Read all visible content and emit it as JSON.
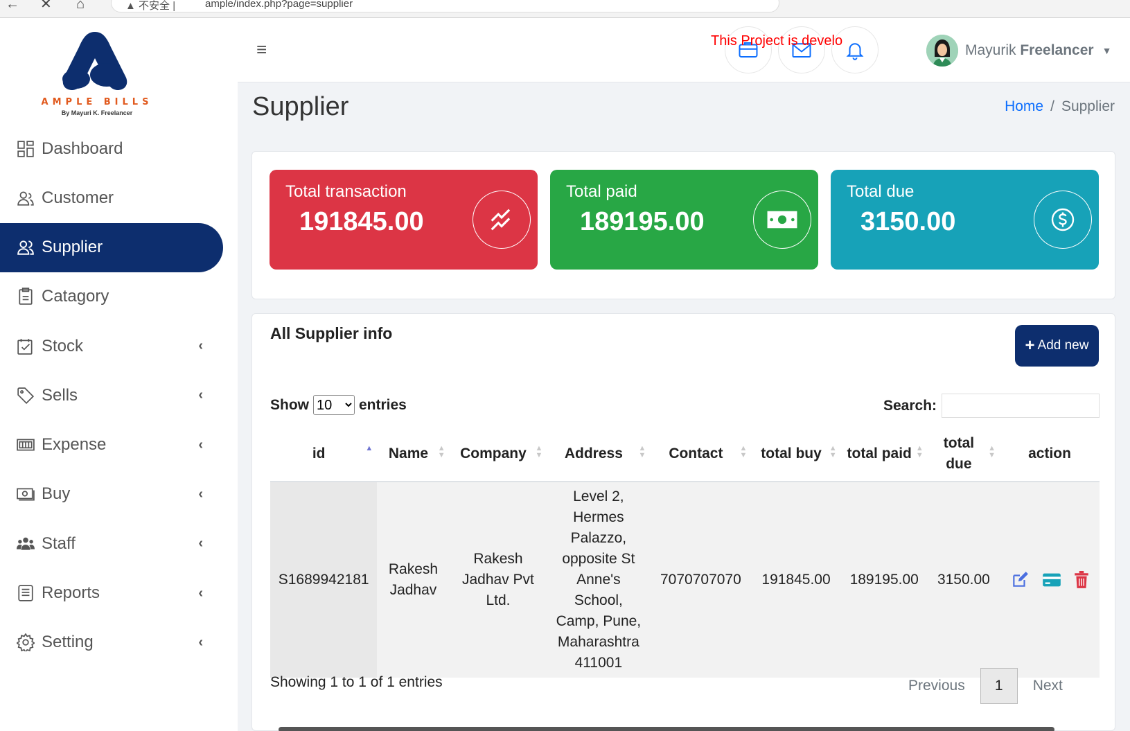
{
  "browser": {
    "url_warning": "不安全",
    "url": "ample/index.php?page=supplier"
  },
  "brand": {
    "name": "AMPLE BILLS",
    "byline": "By Mayuri K. Freelancer",
    "color": "#0d2e6e",
    "accent": "#e15a1e"
  },
  "sidebar": {
    "items": [
      {
        "label": "Dashboard",
        "icon": "dashboard-icon",
        "active": false,
        "expandable": false
      },
      {
        "label": "Customer",
        "icon": "customer-icon",
        "active": false,
        "expandable": false
      },
      {
        "label": "Supplier",
        "icon": "supplier-icon",
        "active": true,
        "expandable": false
      },
      {
        "label": "Catagory",
        "icon": "category-icon",
        "active": false,
        "expandable": false
      },
      {
        "label": "Stock",
        "icon": "stock-icon",
        "active": false,
        "expandable": true
      },
      {
        "label": "Sells",
        "icon": "tag-icon",
        "active": false,
        "expandable": true
      },
      {
        "label": "Expense",
        "icon": "expense-icon",
        "active": false,
        "expandable": true
      },
      {
        "label": "Buy",
        "icon": "money-icon",
        "active": false,
        "expandable": true
      },
      {
        "label": "Staff",
        "icon": "staff-icon",
        "active": false,
        "expandable": true
      },
      {
        "label": "Reports",
        "icon": "report-icon",
        "active": false,
        "expandable": true
      },
      {
        "label": "Setting",
        "icon": "gear-icon",
        "active": false,
        "expandable": true
      }
    ]
  },
  "header": {
    "notice": "This Project is develo",
    "user_first": "Mayurik",
    "user_last": "Freelancer"
  },
  "page": {
    "title": "Supplier",
    "breadcrumb_home": "Home",
    "breadcrumb_sep": "/",
    "breadcrumb_current": "Supplier"
  },
  "stats": [
    {
      "label": "Total transaction",
      "value": "191845.00",
      "color": "#dc3545",
      "icon": "trend-icon"
    },
    {
      "label": "Total paid",
      "value": "189195.00",
      "color": "#28a745",
      "icon": "cash-icon"
    },
    {
      "label": "Total due",
      "value": "3150.00",
      "color": "#17a2b8",
      "icon": "dollar-icon"
    }
  ],
  "table_card": {
    "title": "All Supplier info",
    "add_label": "Add new",
    "show_label": "Show",
    "entries_label": "entries",
    "page_size": "10",
    "search_label": "Search:",
    "columns": [
      "id",
      "Name",
      "Company",
      "Address",
      "Contact",
      "total buy",
      "total paid",
      "total due",
      "action"
    ],
    "rows": [
      {
        "id": "S1689942181",
        "name": "Rakesh Jadhav",
        "company": "Rakesh Jadhav Pvt Ltd.",
        "address": "Level 2, Hermes Palazzo, opposite St Anne's School, Camp, Pune, Maharashtra 411001",
        "contact": "7070707070",
        "total_buy": "191845.00",
        "total_paid": "189195.00",
        "total_due": "3150.00"
      }
    ],
    "info": "Showing 1 to 1 of 1 entries",
    "prev_label": "Previous",
    "page": "1",
    "next_label": "Next"
  }
}
